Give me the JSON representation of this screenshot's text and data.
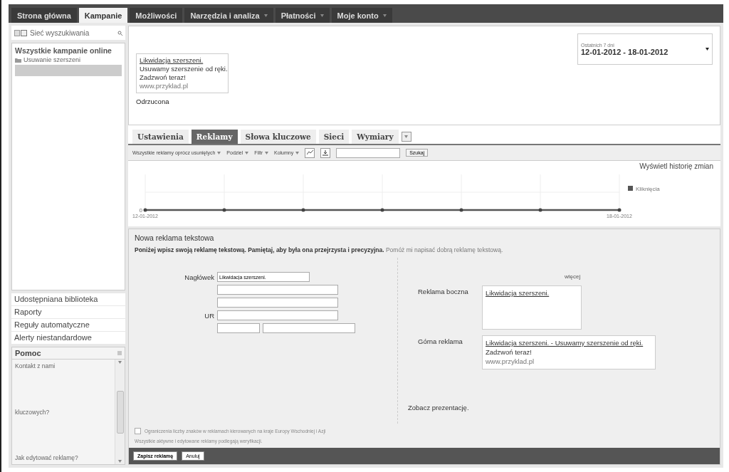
{
  "nav_tabs": [
    {
      "label": "Strona główna",
      "selected": false,
      "dropdown": false
    },
    {
      "label": "Kampanie",
      "selected": true,
      "dropdown": false
    },
    {
      "label": "Możliwości",
      "selected": false,
      "dropdown": false
    },
    {
      "label": "Narzędzia i analiza",
      "selected": false,
      "dropdown": true
    },
    {
      "label": "Płatności",
      "selected": false,
      "dropdown": true
    },
    {
      "label": "Moje konto",
      "selected": false,
      "dropdown": true
    }
  ],
  "sidebar": {
    "network": "Sieć wyszukiwania",
    "tree": {
      "label": "Wszystkie kampanie online",
      "children": [
        {
          "label": "Usuwanie szerszeni",
          "selected": false
        }
      ]
    },
    "menu": [
      "Udostępniana biblioteka",
      "Raporty",
      "Reguły automatyczne",
      "Alerty niestandardowe"
    ],
    "help": {
      "title": "Pomoc",
      "items": [
        "Kontakt z nami",
        "kluczowych?",
        "Jak edytować reklamę?"
      ]
    }
  },
  "ad_preview": {
    "headline": "Likwidacja szerszeni.",
    "line1": "Usuwamy szerszenie od ręki.",
    "line2": "Zadzwoń teraz!",
    "url": "www.przyklad.pl",
    "status": "Odrzucona"
  },
  "date_range": {
    "label": "Ostatnich 7 dni",
    "value": "12-01-2012 - 18-01-2012"
  },
  "sub_tabs": [
    {
      "label": "Ustawienia",
      "selected": false
    },
    {
      "label": "Reklamy",
      "selected": true
    },
    {
      "label": "Słowa kluczowe",
      "selected": false
    },
    {
      "label": "Sieci",
      "selected": false
    },
    {
      "label": "Wymiary",
      "selected": false
    }
  ],
  "toolbar": {
    "filters": [
      "Wszystkie reklamy oprócz usuniętych",
      "Podziel",
      "Filtr",
      "Kolumny"
    ],
    "search_button": "Szukaj"
  },
  "history_link": "Wyświetl historię zmian",
  "chart": {
    "y_label": "0",
    "start_date": "12-01-2012",
    "end_date": "18-01-2012",
    "legend": "Kliknięcia"
  },
  "form": {
    "title": "Nowa reklama tekstowa",
    "intro": "**Poniżej wpisz swoją reklamę tekstową. Pamiętaj, aby była ona przejrzysta i precyzyjna.**",
    "help_link": "Pomóż mi napisać dobrą reklamę tekstową.",
    "fields": [
      {
        "label": "Nagłówek",
        "value": "Likwidacja szerszeni."
      },
      {
        "label": "UR"
      }
    ],
    "more": "więcej",
    "side_label": "Reklama boczna",
    "side_headline": "Likwidacja szerszeni.",
    "top_label": "Górna reklama",
    "top_headline": "Likwidacja szerszeni. - Usuwamy szerszenie od ręki.",
    "top_line": "Zadzwoń teraz!",
    "top_url": "www.przyklad.pl",
    "demo_link": "Zobacz prezentację.",
    "restriction": {
      "label": "Ograniczenia liczby znaków w reklamach kierowanych na kraje Europy Wschodniej i Azji",
      "checked": false
    },
    "note": "Wszystkie aktywne i edytowane reklamy podlegają weryfikacji."
  },
  "buttons": [
    "Zapisz reklamę",
    "Anuluj"
  ]
}
